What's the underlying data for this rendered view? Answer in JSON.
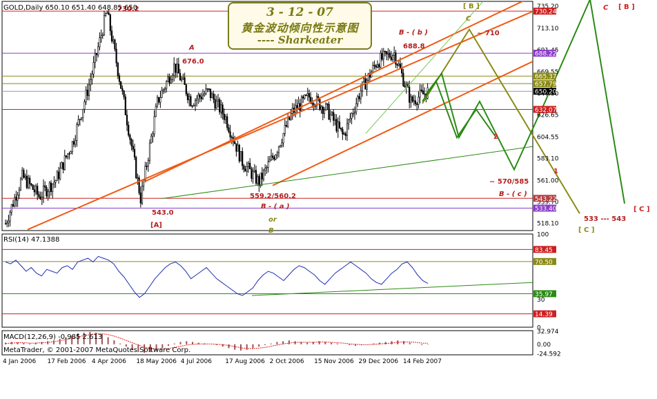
{
  "window": {
    "header_text": "GOLD,Daily  650.10 651.40 648.85 650",
    "copyright": "MetaTrader, © 2001-2007 MetaQuotes Software Corp."
  },
  "title_box": {
    "line1": "3 - 12 - 07",
    "line2": "黄金波动倾向性示意图",
    "line3": "---- Sharkeater"
  },
  "colors": {
    "candle": "#000000",
    "channel": "#f05a14",
    "green_wave": "#2a8a14",
    "olive_wave": "#8a8a14",
    "red_line": "#cc2020",
    "purple_line": "#8c3cc8",
    "rsi_line": "#1c2cb4",
    "macd_hist": "#a05050",
    "label_red": "#b42020"
  },
  "chart_data": [
    {
      "type": "candlestick",
      "name": "GOLD,Daily",
      "ohlc_current": {
        "open": 650.1,
        "high": 651.4,
        "low": 648.85,
        "close": 650.2
      },
      "x_tick_labels": [
        "4 Jan 2006",
        "17 Feb 2006",
        "4 Apr 2006",
        "18 May 2006",
        "4 Jul 2006",
        "17 Aug 2006",
        "2 Oct 2006",
        "15 Nov 2006",
        "29 Dec 2006",
        "14 Feb 2007"
      ],
      "y_tick_labels": [
        "735.20",
        "713.10",
        "691.45",
        "669.55",
        "647.90",
        "626.65",
        "604.55",
        "583.10",
        "561.00",
        "539.70",
        "518.10"
      ],
      "ylim": [
        511,
        740
      ],
      "swing_points": [
        {
          "date": "4 Jan 2006",
          "price": 518.0
        },
        {
          "date": "20 Jan 2006",
          "price": 565.0
        },
        {
          "date": "17 Feb 2006",
          "price": 545.0
        },
        {
          "date": "10 Mar 2006",
          "price": 562.0
        },
        {
          "date": "4 Apr 2006",
          "price": 600.0
        },
        {
          "date": "28 Apr 2006",
          "price": 660.0
        },
        {
          "date": "12 May 2006",
          "price": 730.2
        },
        {
          "date": "25 May 2006",
          "price": 640.0
        },
        {
          "date": "14 Jun 2006",
          "price": 543.0
        },
        {
          "date": "4 Jul 2006",
          "price": 640.0
        },
        {
          "date": "13 Jul 2006",
          "price": 676.0
        },
        {
          "date": "20 Jul 2006",
          "price": 640.0
        },
        {
          "date": "9 Aug 2006",
          "price": 650.0
        },
        {
          "date": "17 Aug 2006",
          "price": 625.0
        },
        {
          "date": "15 Sep 2006",
          "price": 580.0
        },
        {
          "date": "6 Oct 2006",
          "price": 559.2
        },
        {
          "date": "25 Oct 2006",
          "price": 590.0
        },
        {
          "date": "15 Nov 2006",
          "price": 630.0
        },
        {
          "date": "1 Dec 2006",
          "price": 645.0
        },
        {
          "date": "29 Dec 2006",
          "price": 632.0
        },
        {
          "date": "5 Jan 2007",
          "price": 605.0
        },
        {
          "date": "25 Jan 2007",
          "price": 650.0
        },
        {
          "date": "14 Feb 2007",
          "price": 680.0
        },
        {
          "date": "26 Feb 2007",
          "price": 688.8
        },
        {
          "date": "1 Mar 2007",
          "price": 640.0
        },
        {
          "date": "12 Mar 2007",
          "price": 650.2
        }
      ],
      "price_tags": [
        {
          "text": "730.24",
          "price": 730.24,
          "bg": "#cc2020"
        },
        {
          "text": "688.22",
          "price": 688.22,
          "bg": "#8c3cc8"
        },
        {
          "text": "665.37",
          "price": 665.37,
          "bg": "#8a8a14"
        },
        {
          "text": "657.79",
          "price": 657.79,
          "bg": "#8a8a14"
        },
        {
          "text": "650.20",
          "price": 650.2,
          "bg": "#000000"
        },
        {
          "text": "632.07",
          "price": 632.07,
          "bg": "#cc2020"
        },
        {
          "text": "543.22",
          "price": 543.22,
          "bg": "#b44040"
        },
        {
          "text": "533.40",
          "price": 533.4,
          "bg": "#8c3cc8"
        }
      ],
      "annotations": [
        {
          "text": "730.2",
          "color": "#b42020"
        },
        {
          "text": "A",
          "color": "#b42020",
          "italic": true
        },
        {
          "text": "676.0",
          "color": "#b42020"
        },
        {
          "text": "543.0",
          "color": "#b42020"
        },
        {
          "text": "[A]",
          "color": "#b42020"
        },
        {
          "text": "559.2/560.2",
          "color": "#b42020"
        },
        {
          "text": "B - ( a )",
          "color": "#b42020",
          "italic": true
        },
        {
          "text": "or",
          "color": "#8a8a14",
          "italic": true
        },
        {
          "text": "B",
          "color": "#8a8a14",
          "italic": true
        },
        {
          "text": "B - ( b )",
          "color": "#b42020",
          "italic": true
        },
        {
          "text": "688.8",
          "color": "#b42020"
        },
        {
          "text": "[ B ]",
          "color": "#8a8a14"
        },
        {
          "text": "C",
          "color": "#8a8a14",
          "italic": true
        },
        {
          "text": "~ 710",
          "color": "#b42020"
        },
        {
          "text": "2",
          "color": "#cc2020"
        },
        {
          "text": "~ 570/585",
          "color": "#b42020"
        },
        {
          "text": "B - ( c )",
          "color": "#b42020",
          "italic": true
        },
        {
          "text": "1",
          "color": "#cc2020"
        },
        {
          "text": "533 --- 543",
          "color": "#b42020"
        },
        {
          "text": "[ C ]",
          "color": "#8a8a14"
        },
        {
          "text": "C",
          "color": "#cc2020",
          "italic": true
        },
        {
          "text": "[ B ]",
          "color": "#cc2020"
        },
        {
          "text": "[ C ]",
          "color": "#cc2020"
        }
      ]
    },
    {
      "type": "line",
      "name": "RSI(14) 47.1388",
      "ylim": [
        0,
        100
      ],
      "y_tick_labels": [
        "100",
        "83.45",
        "70.50",
        "35.97",
        "30",
        "14.39",
        "0"
      ],
      "levels": [
        83.45,
        70.5,
        35.97,
        14.39
      ],
      "values": [
        70,
        68,
        72,
        66,
        60,
        64,
        58,
        55,
        62,
        60,
        58,
        64,
        66,
        62,
        70,
        72,
        74,
        70,
        76,
        74,
        72,
        68,
        60,
        54,
        46,
        38,
        32,
        36,
        44,
        52,
        58,
        64,
        68,
        70,
        66,
        60,
        52,
        56,
        60,
        64,
        58,
        52,
        48,
        44,
        40,
        36,
        34,
        38,
        42,
        50,
        56,
        60,
        58,
        54,
        50,
        56,
        62,
        66,
        64,
        60,
        56,
        50,
        46,
        52,
        58,
        62,
        66,
        70,
        66,
        62,
        58,
        52,
        48,
        46,
        52,
        58,
        62,
        68,
        70,
        64,
        56,
        50,
        47
      ]
    },
    {
      "type": "bar",
      "name": "MACD(12,26,9) -0.985 2.613",
      "ylim": [
        -27,
        35
      ],
      "y_tick_labels": [
        "32.974",
        "0.00",
        "-24.592"
      ],
      "values": [
        4,
        6,
        5,
        3,
        2,
        4,
        6,
        8,
        10,
        14,
        18,
        22,
        28,
        30,
        32,
        30,
        26,
        18,
        10,
        2,
        -6,
        -14,
        -20,
        -22,
        -20,
        -16,
        -10,
        -4,
        2,
        6,
        8,
        6,
        4,
        2,
        0,
        -2,
        -6,
        -10,
        -14,
        -16,
        -14,
        -10,
        -6,
        -2,
        2,
        6,
        8,
        10,
        8,
        6,
        4,
        6,
        8,
        6,
        4,
        2,
        0,
        -2,
        -4,
        -2,
        0,
        2,
        4,
        6,
        8,
        10,
        8,
        4,
        0,
        -2,
        -1
      ],
      "signal": [
        2,
        3,
        4,
        4,
        3,
        3,
        4,
        5,
        7,
        9,
        12,
        15,
        19,
        22,
        25,
        27,
        27,
        25,
        21,
        16,
        10,
        4,
        -2,
        -7,
        -11,
        -13,
        -13,
        -11,
        -8,
        -5,
        -2,
        0,
        1,
        1,
        1,
        0,
        -1,
        -3,
        -6,
        -9,
        -11,
        -11,
        -10,
        -8,
        -5,
        -2,
        1,
        3,
        5,
        5,
        5,
        5,
        6,
        6,
        5,
        4,
        3,
        1,
        0,
        -1,
        -1,
        0,
        1,
        2,
        3,
        5,
        6,
        6,
        5,
        3,
        2.6
      ]
    }
  ]
}
